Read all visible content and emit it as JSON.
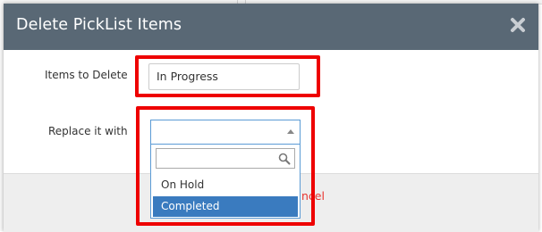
{
  "dialog": {
    "title": "Delete PickList Items",
    "close_icon": "close-icon"
  },
  "form": {
    "items_to_delete_label": "Items to Delete",
    "items_to_delete_value": "In Progress",
    "replace_label": "Replace it with",
    "replace_selected": ""
  },
  "dropdown": {
    "search_placeholder": "",
    "search_icon": "search-icon",
    "options": [
      {
        "label": "On Hold",
        "highlighted": false
      },
      {
        "label": "Completed",
        "highlighted": true
      }
    ]
  },
  "footer": {
    "cancel_label_visible": "ncel"
  },
  "colors": {
    "header_bg": "#596875",
    "highlight_red": "#ee0000",
    "option_selected_bg": "#3a7bbf",
    "cancel_text": "#e8332e"
  }
}
